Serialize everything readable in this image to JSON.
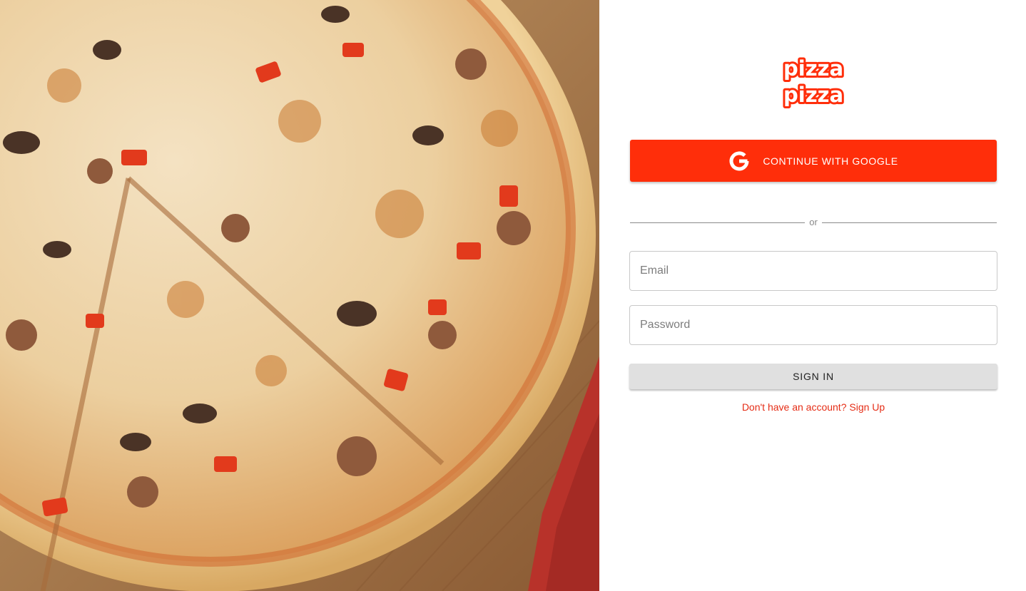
{
  "hero": {
    "image_description_icon": "pizza-photo"
  },
  "brand": {
    "logo_line1": "pizza",
    "logo_line2": "pizza",
    "accent_color": "#ff2e0a",
    "link_color": "#e52d16"
  },
  "auth": {
    "google_label": "CONTINUE WITH GOOGLE",
    "google_icon": "google-g-icon",
    "divider_text": "or",
    "email_placeholder": "Email",
    "email_value": "",
    "password_placeholder": "Password",
    "password_value": "",
    "signin_label": "SIGN IN",
    "signup_text": "Don't have an account? Sign Up"
  }
}
